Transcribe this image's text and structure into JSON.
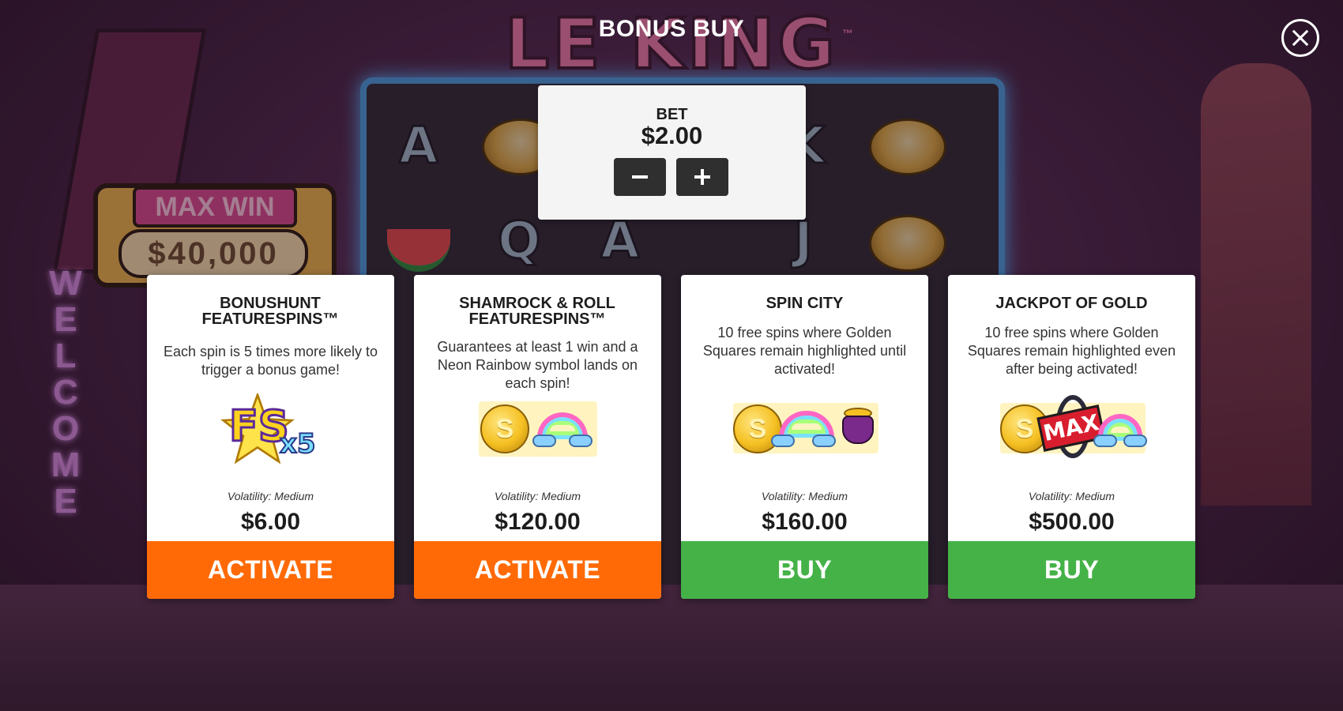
{
  "background": {
    "logo_text": "LE KING",
    "logo_tm": "™",
    "max_win_label": "MAX WIN",
    "max_win_amount": "$40,000",
    "welcome_text": "WELCOME",
    "reel_symbols": [
      "A",
      "K",
      "Q",
      "A",
      "J"
    ]
  },
  "header": {
    "title": "BONUS BUY"
  },
  "bet": {
    "label": "BET",
    "value": "$2.00"
  },
  "cards": [
    {
      "title": "BONUSHUNT FEATURESPINS™",
      "description": "Each spin is 5 times more likely to trigger a bonus game!",
      "art_fs": "FS",
      "art_x5": "x5",
      "volatility": "Volatility: Medium",
      "price": "$6.00",
      "button": "ACTIVATE"
    },
    {
      "title": "SHAMROCK & ROLL FEATURESPINS™",
      "description": "Guarantees at least 1 win and a Neon Rainbow symbol lands on each spin!",
      "art_coin": "S",
      "volatility": "Volatility: Medium",
      "price": "$120.00",
      "button": "ACTIVATE"
    },
    {
      "title": "SPIN CITY",
      "description": "10 free spins where Golden Squares remain highlighted until activated!",
      "art_coin": "S",
      "volatility": "Volatility: Medium",
      "price": "$160.00",
      "button": "BUY"
    },
    {
      "title": "JACKPOT OF GOLD",
      "description": "10 free spins where Golden Squares remain highlighted even after being activated!",
      "art_coin": "S",
      "art_max": "MAX",
      "volatility": "Volatility: Medium",
      "price": "$500.00",
      "button": "BUY"
    }
  ],
  "colors": {
    "activate": "#ff6a06",
    "buy": "#45b248",
    "card_bg": "#ffffff",
    "bet_panel_bg": "#f4f4f4"
  },
  "icons": {
    "close": "close-icon",
    "minus": "minus-icon",
    "plus": "plus-icon"
  }
}
